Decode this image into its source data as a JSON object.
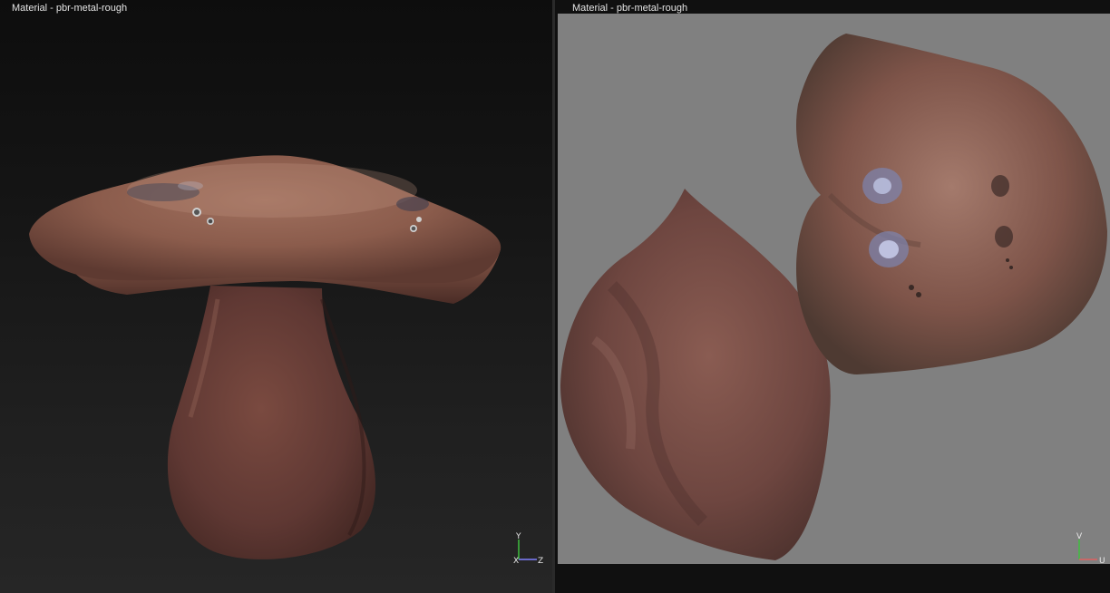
{
  "viewports": {
    "model": {
      "label": "Material - pbr-metal-rough",
      "gizmo": {
        "up": "Y",
        "right": "Z",
        "origin": "X"
      }
    },
    "uv": {
      "label": "Material - pbr-metal-rough",
      "gizmo": {
        "up": "V",
        "right": "U"
      }
    }
  },
  "colors": {
    "uv_background": "#808080",
    "skin": "#8a5a4c",
    "axis_up": "#3fbf3f",
    "axis_right": "#8080ff",
    "axis_u": "#e06060"
  },
  "icons": [
    "axis-gizmo-icon"
  ]
}
